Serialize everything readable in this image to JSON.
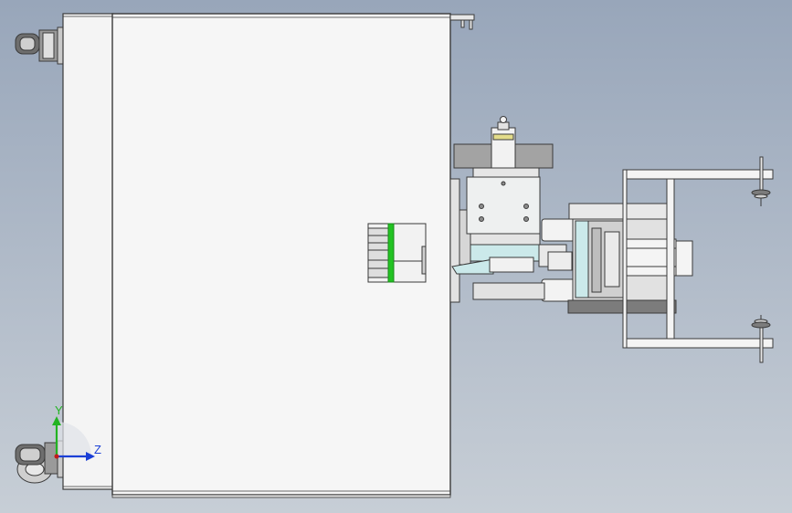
{
  "viewport": {
    "background_top": "#98a6ba",
    "background_bottom": "#c7ced6"
  },
  "triad": {
    "y_label": "Y",
    "z_label": "Z",
    "y_color": "#22b322",
    "z_color": "#1a3fd6"
  },
  "colors": {
    "body_fill": "#f4f4f4",
    "body_stroke": "#3a3a3a",
    "part_dark": "#7c7c7c",
    "part_gray": "#b8b8b8",
    "part_light": "#e7ebeb",
    "cyan_part": "#cbe9ea",
    "green_accent": "#22c322",
    "yellow_accent": "#e3dc8a"
  }
}
